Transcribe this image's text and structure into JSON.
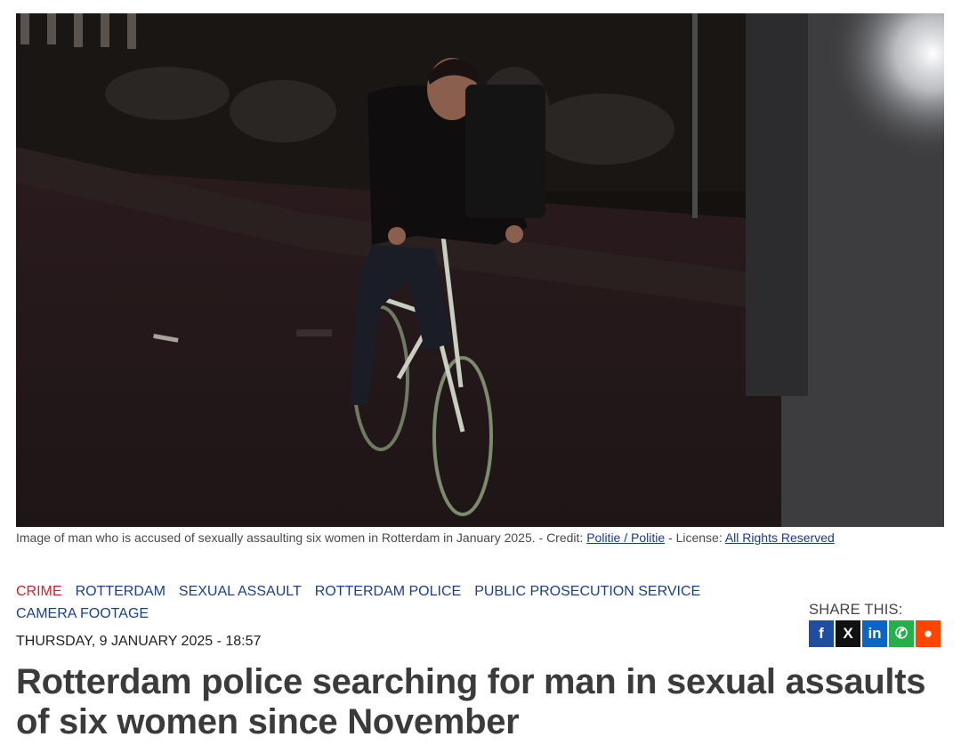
{
  "hero": {
    "image_name": "man-on-bicycle-night-photo"
  },
  "caption": {
    "text": "Image of man who is accused of sexually assaulting six women in Rotterdam in January 2025. - Credit: ",
    "credit_link": "Politie / Politie",
    "license_prefix": " - License: ",
    "license_link": "All Rights Reserved"
  },
  "tags": [
    {
      "label": "CRIME",
      "category": true
    },
    {
      "label": "ROTTERDAM",
      "category": false
    },
    {
      "label": "SEXUAL ASSAULT",
      "category": false
    },
    {
      "label": "ROTTERDAM POLICE",
      "category": false
    },
    {
      "label": "PUBLIC PROSECUTION SERVICE",
      "category": false
    },
    {
      "label": "CAMERA FOOTAGE",
      "category": false
    }
  ],
  "date": "THURSDAY, 9 JANUARY 2025 - 18:57",
  "share": {
    "label": "SHARE THIS:",
    "icons": [
      {
        "name": "facebook-icon",
        "glyph": "f"
      },
      {
        "name": "x-icon",
        "glyph": "X"
      },
      {
        "name": "linkedin-icon",
        "glyph": "in"
      },
      {
        "name": "whatsapp-icon",
        "glyph": "✆"
      },
      {
        "name": "reddit-icon",
        "glyph": "●"
      }
    ]
  },
  "headline": "Rotterdam police searching for man in sexual assaults of six women since November",
  "colors": {
    "category": "#d61f26",
    "tag": "#1a3f8f",
    "headline": "#3b3b3b"
  }
}
